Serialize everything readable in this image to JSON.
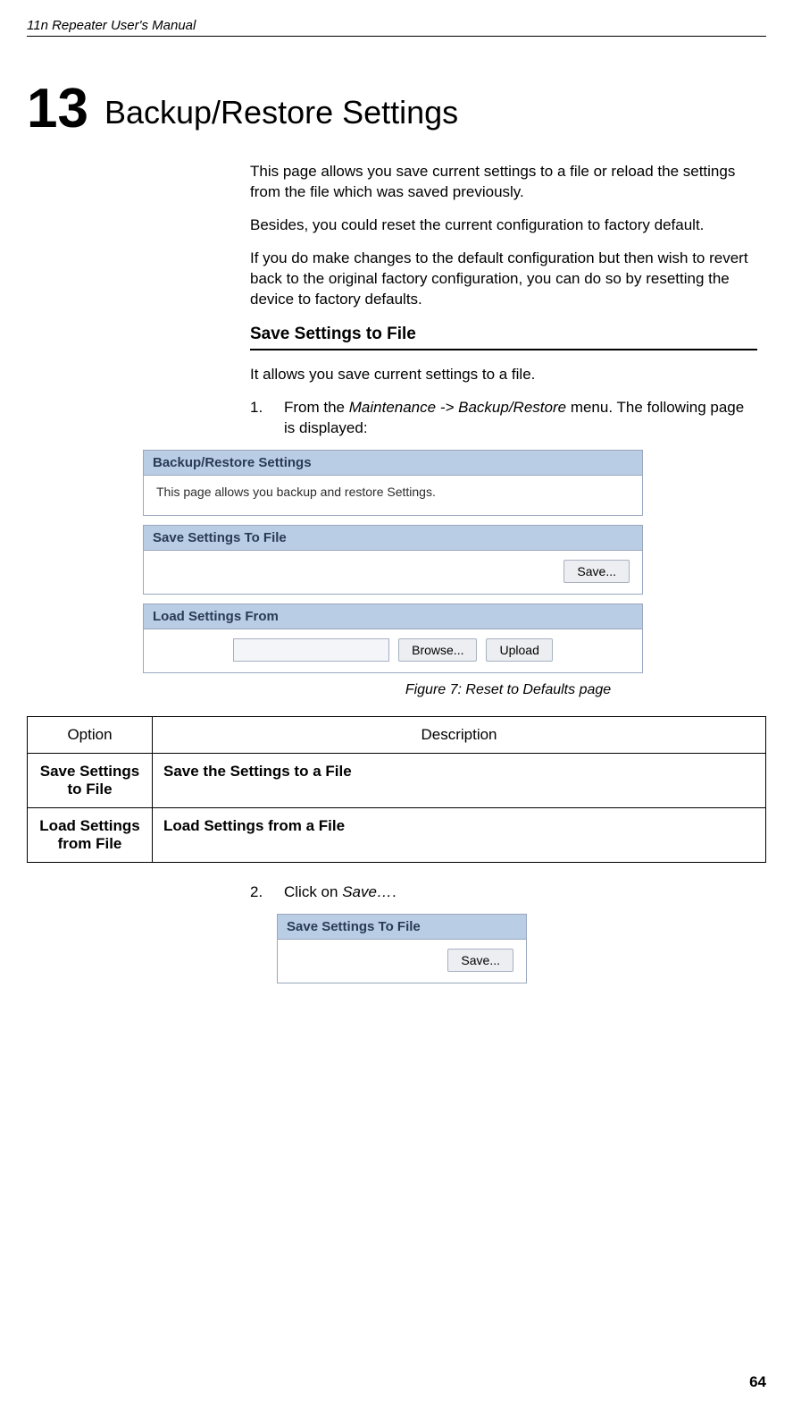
{
  "doc": {
    "header": "11n Repeater User's Manual",
    "chapter_number": "13",
    "chapter_title": "Backup/Restore Settings",
    "intro_p1": "This page allows you save current settings to a file or reload the settings from the file which was saved previously.",
    "intro_p2": "Besides, you could reset the current configuration to factory default.",
    "intro_p3": "If you do make changes to the default configuration but then wish to revert back to the original factory configuration, you can do so by resetting the device to factory defaults.",
    "section_heading": "Save Settings to File",
    "section_p1": "It allows you save current settings to a file.",
    "step1_num": "1.",
    "step1_prefix": "From the ",
    "step1_menu": "Maintenance -> Backup/Restore",
    "step1_suffix": " menu. The following page is displayed:",
    "step2_num": "2.",
    "step2_prefix": "Click on ",
    "step2_action": "Save…",
    "step2_period": ".",
    "figure_caption": "Figure 7:        Reset to Defaults page",
    "page_number": "64"
  },
  "ui_main": {
    "title": "Backup/Restore Settings",
    "description": "This page allows you backup and restore Settings.",
    "save_panel_title": "Save Settings To File",
    "load_panel_title": "Load Settings From",
    "save_button": "Save...",
    "browse_button": "Browse...",
    "upload_button": "Upload"
  },
  "ui_small": {
    "title": "Save Settings To File",
    "save_button": "Save..."
  },
  "table": {
    "col_option": "Option",
    "col_description": "Description",
    "row1_opt": "Save Settings to File",
    "row1_desc": "Save the Settings to a File",
    "row2_opt": "Load Settings from File",
    "row2_desc": "Load Settings from a File"
  }
}
